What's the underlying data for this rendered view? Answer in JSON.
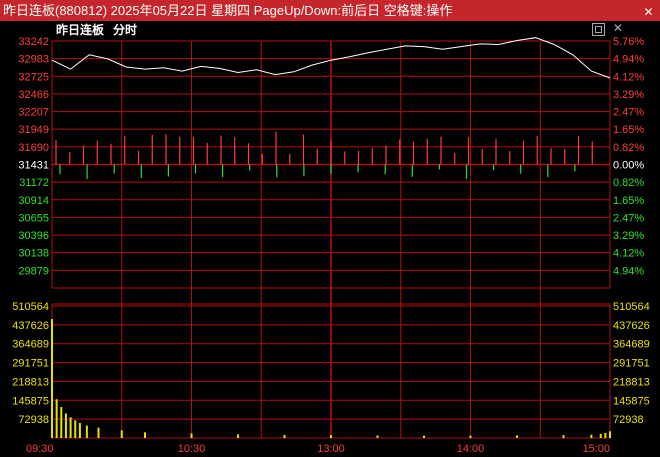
{
  "window": {
    "title": "昨日连板(880812) 2025年05月22日 星期四 PageUp/Down:前后日 空格键:操作",
    "close_glyph": "✕"
  },
  "subheader": {
    "title": "昨日连板",
    "mode": "分时",
    "close_glyph": "✕"
  },
  "colors": {
    "up": "#ff3c3c",
    "down": "#2ee02e",
    "neutral": "#ffffff",
    "volume": "#e8e000",
    "grid": "#b01010",
    "price_line": "#ffffff",
    "title_bar": "#c4262b"
  },
  "chart_data": {
    "type": "line",
    "prev_close": 31431,
    "price_axis": {
      "min": 29620,
      "max": 33242,
      "ticks": [
        33242,
        32983,
        32725,
        32466,
        32207,
        31949,
        31690,
        31431,
        31172,
        30914,
        30655,
        30396,
        30138,
        29879
      ],
      "pct_ticks": [
        "5.76%",
        "4.94%",
        "4.12%",
        "3.29%",
        "2.47%",
        "1.65%",
        "0.82%",
        "0.00%",
        "0.82%",
        "1.65%",
        "2.47%",
        "3.29%",
        "4.12%",
        "4.94%"
      ]
    },
    "volume_axis": {
      "min": 0,
      "max": 510564,
      "ticks": [
        510564,
        437626,
        364689,
        291751,
        218813,
        145875,
        72938
      ]
    },
    "time_ticks": [
      "09:30",
      "10:30",
      "13:00",
      "14:00",
      "15:00"
    ],
    "price_series": {
      "name": "",
      "x": [
        0,
        8,
        16,
        24,
        32,
        40,
        48,
        56,
        64,
        72,
        80,
        88,
        96,
        104,
        112,
        120,
        128,
        136,
        144,
        152,
        160,
        168,
        176,
        184,
        192,
        200,
        208,
        216,
        224,
        232,
        240
      ],
      "y": [
        32960,
        32830,
        33040,
        32980,
        32860,
        32830,
        32850,
        32800,
        32870,
        32840,
        32780,
        32820,
        32750,
        32790,
        32890,
        32960,
        33010,
        33070,
        33120,
        33170,
        33160,
        33120,
        33160,
        33200,
        33190,
        33250,
        33290,
        33190,
        33040,
        32800,
        32700
      ]
    },
    "volume_series": {
      "name": "",
      "x": [
        0,
        2,
        4,
        6,
        8,
        10,
        12,
        15,
        20,
        30,
        40,
        60,
        80,
        100,
        120,
        140,
        160,
        180,
        200,
        220,
        232,
        236,
        238,
        240
      ],
      "y": [
        460000,
        150000,
        120000,
        95000,
        80000,
        68000,
        58000,
        48000,
        40000,
        30000,
        22000,
        18000,
        14000,
        12000,
        11000,
        10000,
        9000,
        9000,
        10000,
        11000,
        13000,
        16000,
        20000,
        26000
      ]
    },
    "ratio_bars": {
      "up": [
        0.69,
        0.35,
        0.54,
        0.68,
        0.59,
        0.81,
        0.39,
        0.84,
        0.86,
        0.79,
        0.77,
        0.61,
        0.82,
        0.77,
        0.6,
        0.31,
        0.93,
        0.3,
        0.85,
        0.45,
        0.67,
        0.37,
        0.39,
        0.46,
        0.54,
        0.71,
        0.65,
        0.73,
        0.79,
        0.32,
        0.77,
        0.44,
        0.72,
        0.38,
        0.67,
        0.81,
        0.46,
        0.44,
        0.8,
        0.65
      ],
      "down": [
        0.35,
        0.52,
        0.32,
        0.48,
        0.43,
        0.32,
        0.45,
        0.22,
        0.46,
        0.42,
        0.34,
        0.28,
        0.35,
        0.44,
        0.18,
        0.52,
        0.2,
        0.33,
        0.45,
        0.25
      ]
    }
  }
}
